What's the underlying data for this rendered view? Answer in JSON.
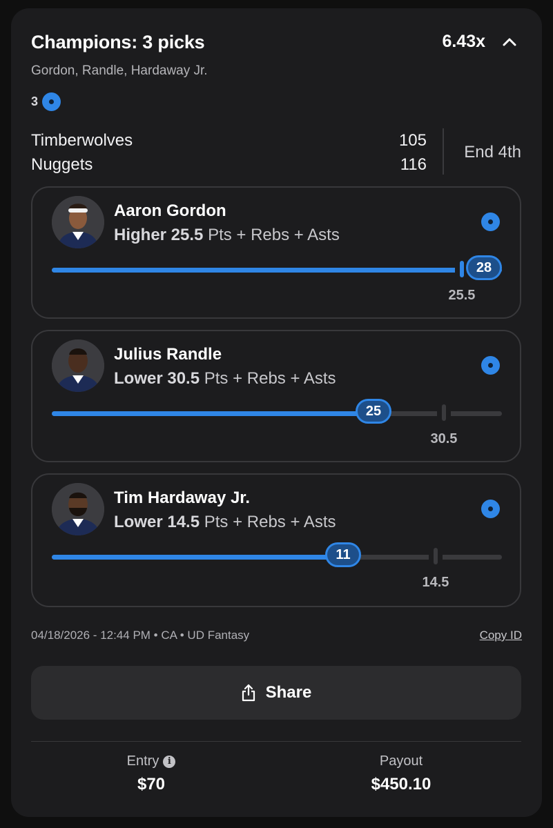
{
  "header": {
    "title": "Champions: 3 picks",
    "multiplier": "6.43x",
    "subtitle": "Gordon, Randle, Hardaway Jr.",
    "count": "3",
    "chevron_icon": "chevron-up-icon"
  },
  "game": {
    "team1": "Timberwolves",
    "score1": "105",
    "team2": "Nuggets",
    "score2": "116",
    "status": "End 4th"
  },
  "picks": [
    {
      "name": "Aaron Gordon",
      "direction": "Higher 25.5",
      "stat": "Pts + Rebs + Asts",
      "line": "25.5",
      "actual": "28",
      "line_value": 25.5,
      "actual_value": 28,
      "scale_max": 28,
      "status_icon": "hit-dot-icon"
    },
    {
      "name": "Julius Randle",
      "direction": "Lower 30.5",
      "stat": "Pts + Rebs + Asts",
      "line": "30.5",
      "actual": "25",
      "line_value": 30.5,
      "actual_value": 25,
      "scale_max": 35,
      "status_icon": "hit-dot-icon"
    },
    {
      "name": "Tim Hardaway Jr.",
      "direction": "Lower 14.5",
      "stat": "Pts + Rebs + Asts",
      "line": "14.5",
      "actual": "11",
      "line_value": 14.5,
      "actual_value": 11,
      "scale_max": 17,
      "status_icon": "hit-dot-icon"
    }
  ],
  "meta": {
    "info": "04/18/2026 - 12:44 PM • CA • UD Fantasy",
    "copy_id": "Copy ID"
  },
  "share": {
    "label": "Share",
    "icon": "share-icon"
  },
  "footer": {
    "entry_label": "Entry",
    "entry_value": "$70",
    "payout_label": "Payout",
    "payout_value": "$450.10"
  },
  "colors": {
    "accent": "#2f86e6",
    "card_bg": "#1c1c1e",
    "page_bg": "#0f0f0f"
  }
}
